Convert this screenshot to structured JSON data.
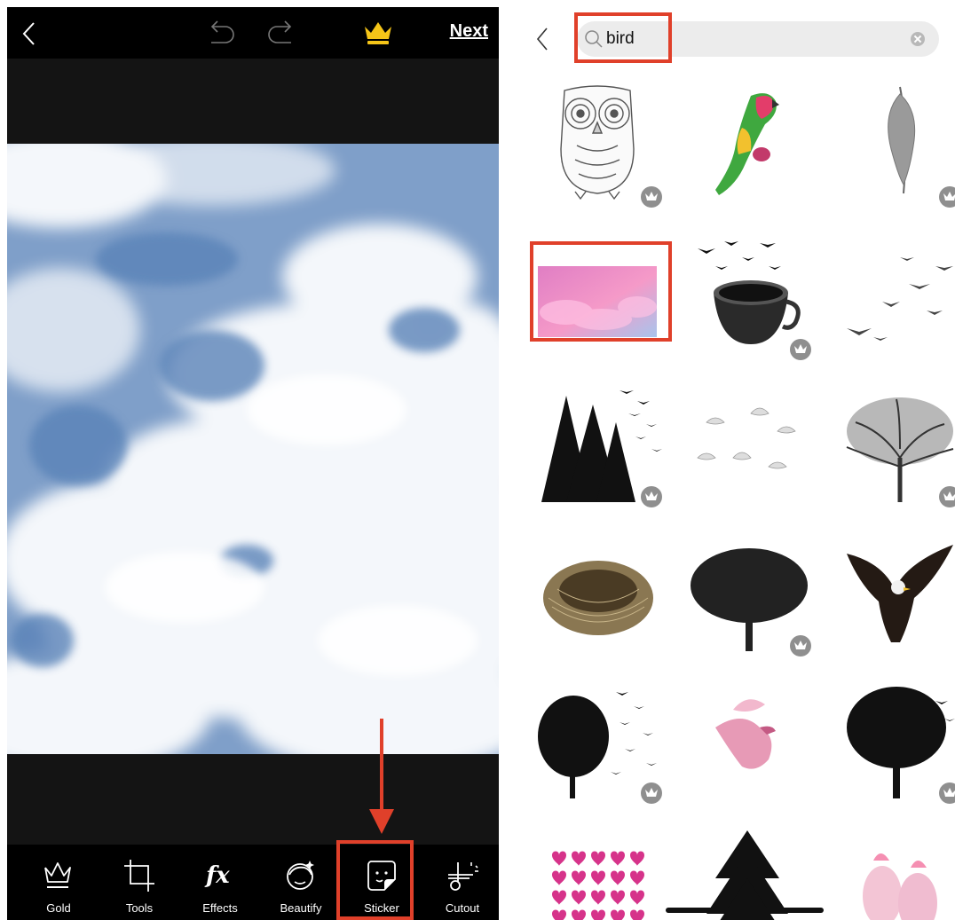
{
  "editor": {
    "next_label": "Next",
    "accent_color": "#e0402a",
    "crown_color": "#f5c518",
    "toolbar": [
      {
        "label": "Gold",
        "icon": "crown-outline-icon"
      },
      {
        "label": "Tools",
        "icon": "crop-icon"
      },
      {
        "label": "Effects",
        "icon": "fx-icon"
      },
      {
        "label": "Beautify",
        "icon": "face-icon"
      },
      {
        "label": "Sticker",
        "icon": "sticker-icon",
        "highlighted": true
      },
      {
        "label": "Cutout",
        "icon": "scissors-icon"
      }
    ]
  },
  "sticker_search": {
    "query": "bird",
    "results": [
      {
        "subject": "owl line drawing",
        "premium": true
      },
      {
        "subject": "parrot",
        "premium": false
      },
      {
        "subject": "feather",
        "premium": true
      },
      {
        "subject": "pink clouds",
        "premium": false,
        "highlighted": true
      },
      {
        "subject": "coffee cup with birds",
        "premium": true
      },
      {
        "subject": "flying birds",
        "premium": false
      },
      {
        "subject": "pine trees with birds",
        "premium": true
      },
      {
        "subject": "doves",
        "premium": false
      },
      {
        "subject": "bare tree",
        "premium": true
      },
      {
        "subject": "bird nest",
        "premium": false
      },
      {
        "subject": "tree silhouette",
        "premium": true
      },
      {
        "subject": "eagle",
        "premium": false
      },
      {
        "subject": "tree with birds flying",
        "premium": true
      },
      {
        "subject": "pink bird",
        "premium": false
      },
      {
        "subject": "tree silhouette with birds",
        "premium": true
      },
      {
        "subject": "hearts and doves",
        "premium": false
      },
      {
        "subject": "pine tree",
        "premium": false
      },
      {
        "subject": "pink cockatoos",
        "premium": false
      }
    ]
  }
}
